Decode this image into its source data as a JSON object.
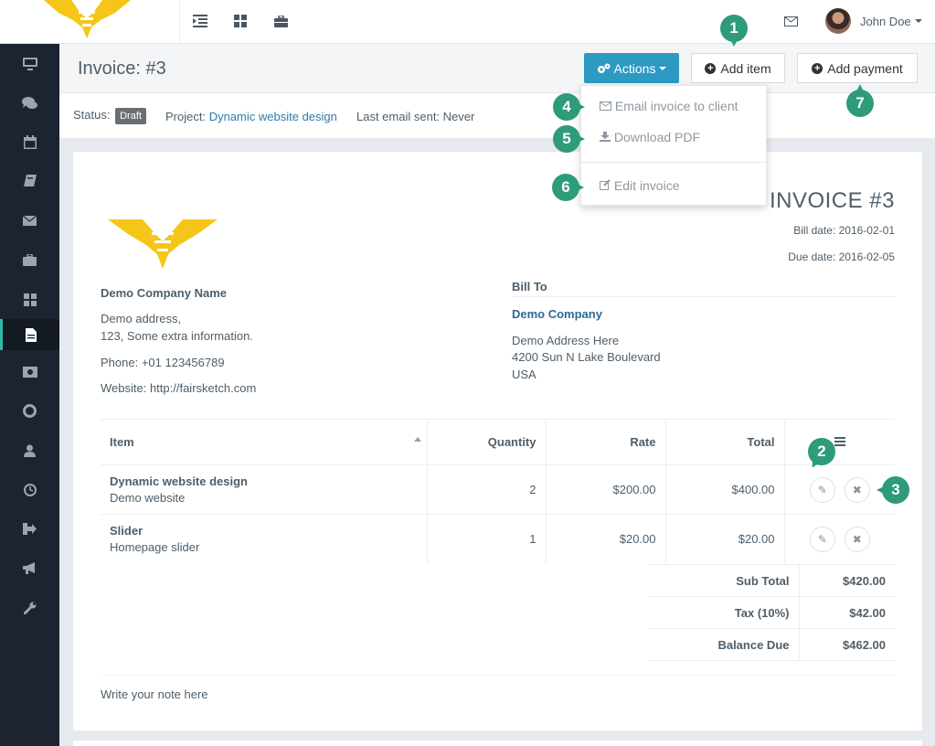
{
  "topbar": {
    "user_name": "John Doe",
    "icons": [
      "indent-icon",
      "grid-icon",
      "briefcase-icon",
      "envelope-icon"
    ]
  },
  "sidebar": {
    "items": [
      {
        "icon": "desktop-icon"
      },
      {
        "icon": "comments-icon"
      },
      {
        "icon": "calendar-icon"
      },
      {
        "icon": "book-icon"
      },
      {
        "icon": "envelope-icon"
      },
      {
        "icon": "briefcase-icon"
      },
      {
        "icon": "grid-icon"
      },
      {
        "icon": "file-icon",
        "active": true
      },
      {
        "icon": "money-icon"
      },
      {
        "icon": "life-ring-icon"
      },
      {
        "icon": "user-icon"
      },
      {
        "icon": "clock-icon"
      },
      {
        "icon": "sign-out-icon"
      },
      {
        "icon": "bullhorn-icon"
      },
      {
        "icon": "wrench-icon"
      }
    ]
  },
  "header": {
    "title": "Invoice: #3",
    "actions_label": "Actions",
    "add_item_label": "Add item",
    "add_payment_label": "Add payment"
  },
  "status": {
    "status_label": "Status:",
    "status_value": "Draft",
    "project_label": "Project:",
    "project_value": "Dynamic website design",
    "last_email": "Last email sent: Never"
  },
  "dropdown": {
    "email": "Email invoice to client",
    "download": "Download PDF",
    "edit": "Edit invoice"
  },
  "invoice": {
    "title": "INVOICE #3",
    "bill_date": "Bill date: 2016-02-01",
    "due_date": "Due date: 2016-02-05",
    "company": {
      "name": "Demo Company Name",
      "address1": "Demo address,",
      "address2": "123, Some extra information.",
      "phone": "Phone: +01 123456789",
      "website": "Website: http://fairsketch.com"
    },
    "bill_to": {
      "label": "Bill To",
      "name": "Demo Company",
      "line1": "Demo Address Here",
      "line2": "4200 Sun N Lake Boulevard",
      "line3": "USA"
    },
    "columns": {
      "item": "Item",
      "quantity": "Quantity",
      "rate": "Rate",
      "total": "Total"
    },
    "rows": [
      {
        "name": "Dynamic website design",
        "desc": "Demo website",
        "qty": "2",
        "rate": "$200.00",
        "total": "$400.00"
      },
      {
        "name": "Slider",
        "desc": "Homepage slider",
        "qty": "1",
        "rate": "$20.00",
        "total": "$20.00"
      }
    ],
    "totals": {
      "subtotal_label": "Sub Total",
      "subtotal": "$420.00",
      "tax_label": "Tax (10%)",
      "tax": "$42.00",
      "balance_label": "Balance Due",
      "balance": "$462.00"
    },
    "note": "Write your note here"
  },
  "callouts": [
    "1",
    "2",
    "3",
    "4",
    "5",
    "6",
    "7"
  ],
  "colors": {
    "sidebar": "#1c2431",
    "accent": "#2d9ac4",
    "callout": "#2e9b7a",
    "link": "#2d7ab0"
  }
}
